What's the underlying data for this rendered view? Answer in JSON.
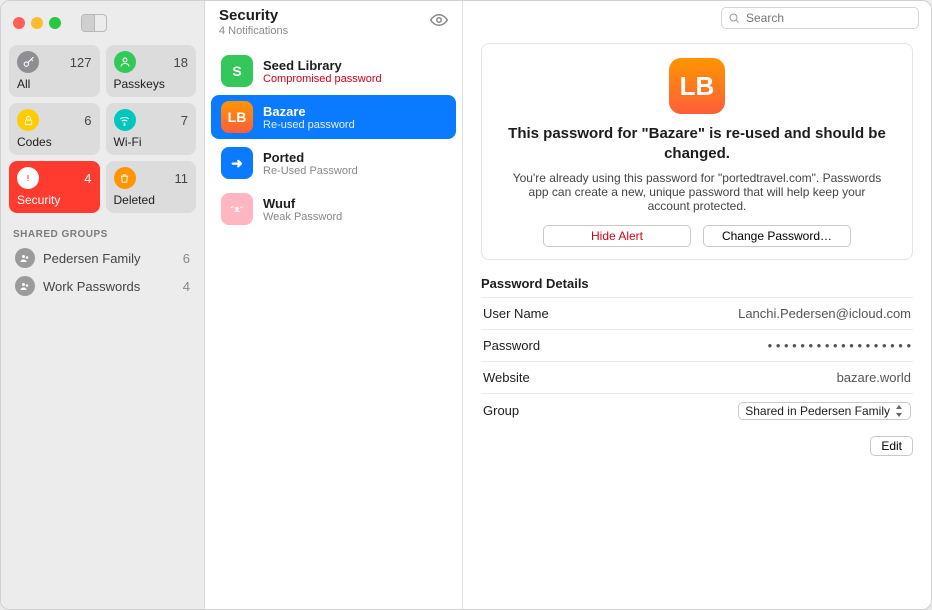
{
  "sidebar": {
    "categories": [
      {
        "label": "All",
        "count": "127",
        "color": "#8e8e93",
        "glyph": "key"
      },
      {
        "label": "Passkeys",
        "count": "18",
        "color": "#34c759",
        "glyph": "person"
      },
      {
        "label": "Codes",
        "count": "6",
        "color": "#ffcc00",
        "glyph": "lock"
      },
      {
        "label": "Wi-Fi",
        "count": "7",
        "color": "#00c7be",
        "glyph": "wifi"
      },
      {
        "label": "Security",
        "count": "4",
        "color": "#ff3b30",
        "glyph": "alert"
      },
      {
        "label": "Deleted",
        "count": "11",
        "color": "#ff9500",
        "glyph": "trash"
      }
    ],
    "active_index": 4,
    "shared_header": "SHARED GROUPS",
    "shared_groups": [
      {
        "label": "Pedersen Family",
        "count": "6"
      },
      {
        "label": "Work Passwords",
        "count": "4"
      }
    ]
  },
  "middle": {
    "title": "Security",
    "subtitle": "4 Notifications",
    "items": [
      {
        "name": "Seed Library",
        "sub": "Compromised password",
        "sub_style": "red",
        "icon_bg": "#34c759",
        "icon_text": "S"
      },
      {
        "name": "Bazare",
        "sub": "Re-used password",
        "sub_style": "sel",
        "icon_bg": "linear-gradient(180deg,#ff9500,#ff5e3a)",
        "icon_text": "LB"
      },
      {
        "name": "Ported",
        "sub": "Re-Used Password",
        "sub_style": "gray",
        "icon_bg": "#0a7aff",
        "icon_text": "➜"
      },
      {
        "name": "Wuuf",
        "sub": "Weak Password",
        "sub_style": "gray",
        "icon_bg": "#ffb6c1",
        "icon_text": "ᵔᴥᵔ"
      }
    ],
    "selected_index": 1
  },
  "detail": {
    "search_placeholder": "Search",
    "alert": {
      "icon_text": "LB",
      "title": "This password for \"Bazare\" is re-used and should be changed.",
      "message": "You're already using this password for \"portedtravel.com\". Passwords app can create a new, unique password that will help keep your account protected.",
      "hide_label": "Hide Alert",
      "change_label": "Change Password…"
    },
    "section_title": "Password Details",
    "rows": {
      "username_k": "User Name",
      "username_v": "Lanchi.Pedersen@icloud.com",
      "password_k": "Password",
      "password_v": "• • • • • • • • • • • • • • • • • •",
      "website_k": "Website",
      "website_v": "bazare.world",
      "group_k": "Group",
      "group_v": "Shared in Pedersen Family"
    },
    "edit_label": "Edit"
  }
}
